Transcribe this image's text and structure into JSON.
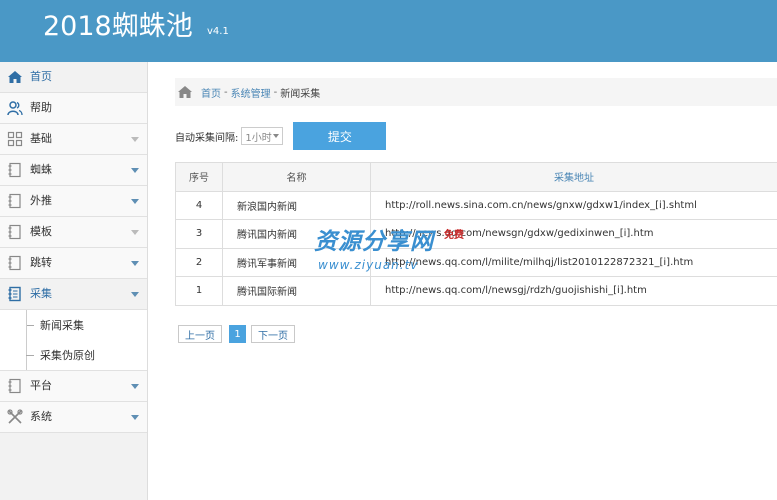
{
  "header": {
    "brand": "2018蜘蛛池",
    "version": "v4.1"
  },
  "sidebar": {
    "items": [
      {
        "label": "首页",
        "icon": "home-icon",
        "active": true
      },
      {
        "label": "帮助",
        "icon": "users-icon"
      },
      {
        "label": "基础",
        "icon": "grid-icon"
      },
      {
        "label": "蜘蛛",
        "icon": "notebook-icon"
      },
      {
        "label": "外推",
        "icon": "notebook-icon"
      },
      {
        "label": "模板",
        "icon": "notebook-icon"
      },
      {
        "label": "跳转",
        "icon": "notebook-icon"
      },
      {
        "label": "采集",
        "icon": "notebook-icon",
        "active": true
      },
      {
        "label": "平台",
        "icon": "notebook-icon"
      },
      {
        "label": "系统",
        "icon": "tools-icon"
      }
    ],
    "submenu": [
      "新闻采集",
      "采集伪原创"
    ]
  },
  "breadcrumb": {
    "home": "首页",
    "section": "系统管理",
    "current": "新闻采集",
    "sep": "-"
  },
  "form": {
    "label": "自动采集间隔:",
    "select_value": "1小时",
    "submit": "提交"
  },
  "table": {
    "headers": [
      "序号",
      "名称",
      "采集地址"
    ],
    "rows": [
      {
        "id": "4",
        "name": "新浪国内新闻",
        "url": "http://roll.news.sina.com.cn/news/gnxw/gdxw1/index_[i].shtml"
      },
      {
        "id": "3",
        "name": "腾讯国内新闻",
        "url": "http://news.qq.com/newsgn/gdxw/gedixinwen_[i].htm"
      },
      {
        "id": "2",
        "name": "腾讯军事新闻",
        "url": "http://news.qq.com/l/milite/milhqj/list2010122872321_[i].htm"
      },
      {
        "id": "1",
        "name": "腾讯国际新闻",
        "url": "http://news.qq.com/l/newsgj/rdzh/guojishishi_[i].htm"
      }
    ]
  },
  "pager": {
    "prev": "上一页",
    "current": "1",
    "next": "下一页"
  },
  "watermark": {
    "main": "资源分享网",
    "badge": "免费",
    "sub": "www.ziyuan.tv"
  },
  "colors": {
    "accent": "#4a98c6",
    "button": "#4aa3df",
    "link": "#4a86b5"
  }
}
